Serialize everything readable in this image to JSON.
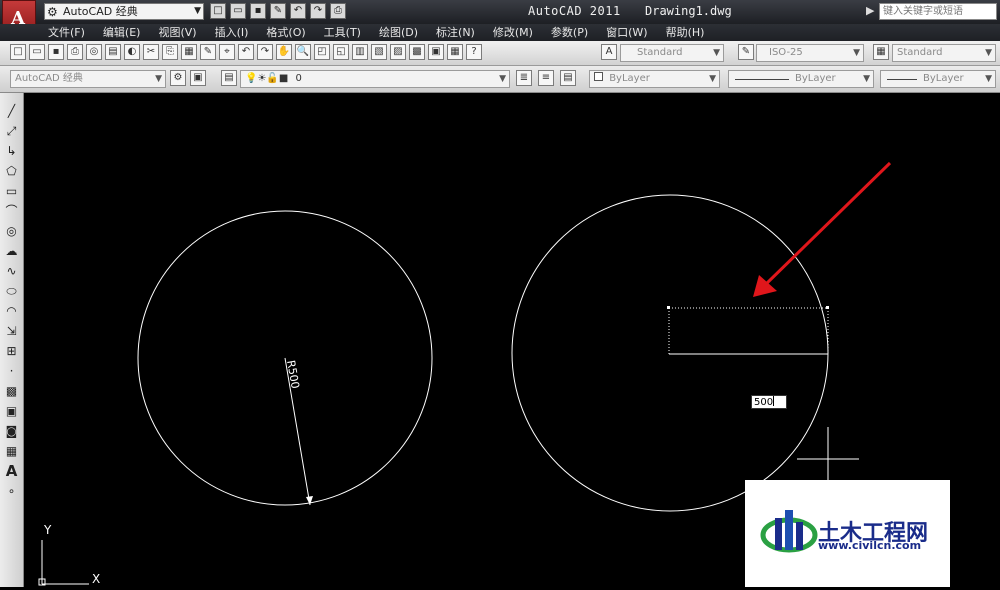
{
  "titlebar": {
    "app_logo_letter": "A",
    "workspace": "AutoCAD 经典",
    "app_title": "AutoCAD 2011",
    "doc_title": "Drawing1.dwg",
    "help_search_placeholder": "键入关键字或短语",
    "quick_access": [
      "new-icon",
      "open-icon",
      "save-icon",
      "saveas-icon",
      "undo-icon",
      "redo-icon",
      "plot-icon"
    ]
  },
  "menu": {
    "items": [
      "文件(F)",
      "编辑(E)",
      "视图(V)",
      "插入(I)",
      "格式(O)",
      "工具(T)",
      "绘图(D)",
      "标注(N)",
      "修改(M)",
      "参数(P)",
      "窗口(W)",
      "帮助(H)"
    ]
  },
  "toolbar1": {
    "text_style": "Standard",
    "dim_style": "ISO-25",
    "table_style": "Standard"
  },
  "toolbar2": {
    "workspace": "AutoCAD 经典",
    "layer": "0",
    "color": "ByLayer",
    "linetype": "ByLayer",
    "lineweight": "ByLayer"
  },
  "drawing": {
    "dimension_text": "R500",
    "dynamic_input_value": "500",
    "ucs_x_label": "X",
    "ucs_y_label": "Y",
    "annotation_arrow_color": "#e0161b"
  },
  "watermark": {
    "name": "土木工程网",
    "url": "www.civilcn.com"
  }
}
